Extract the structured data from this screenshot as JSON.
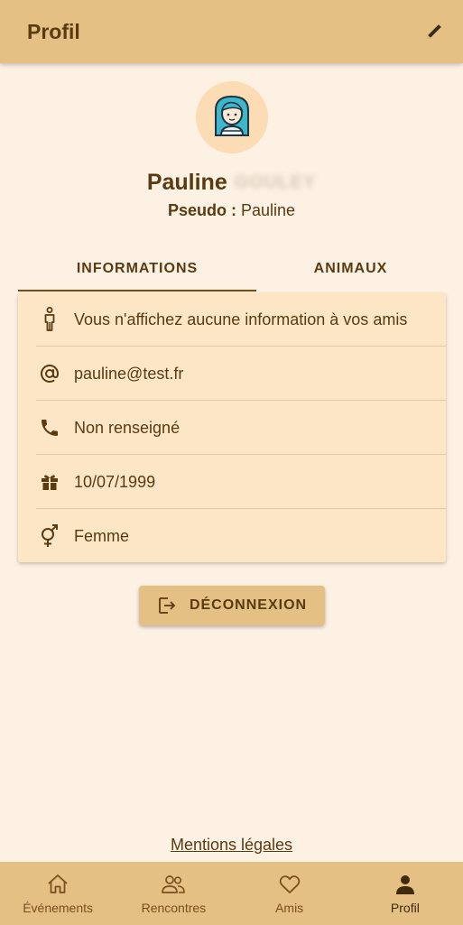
{
  "appbar": {
    "title": "Profil",
    "edit_icon": "pencil-icon"
  },
  "profile": {
    "first_name": "Pauline",
    "last_name": "GOULEY",
    "pseudo_label": "Pseudo :",
    "pseudo_value": "Pauline",
    "avatar_icon": "woman-avatar-icon"
  },
  "tabs": [
    {
      "label": "INFORMATIONS",
      "selected": true
    },
    {
      "label": "ANIMAUX",
      "selected": false
    }
  ],
  "info": [
    {
      "icon": "person-standing-icon",
      "text": "Vous n'affichez aucune information à vos amis"
    },
    {
      "icon": "at-sign-icon",
      "text": "pauline@test.fr"
    },
    {
      "icon": "phone-icon",
      "text": "Non renseigné"
    },
    {
      "icon": "gift-icon",
      "text": "10/07/1999"
    },
    {
      "icon": "gender-icon",
      "text": "Femme"
    }
  ],
  "logout": {
    "label": "DÉCONNEXION",
    "icon": "logout-icon"
  },
  "legal_link": "Mentions légales",
  "bottom_nav": [
    {
      "label": "Événements",
      "icon": "home-icon",
      "active": false
    },
    {
      "label": "Rencontres",
      "icon": "people-icon",
      "active": false
    },
    {
      "label": "Amis",
      "icon": "heart-icon",
      "active": false
    },
    {
      "label": "Profil",
      "icon": "person-icon",
      "active": true
    }
  ],
  "colors": {
    "background": "#fdf1e3",
    "bar": "#e5c085",
    "card": "#fde6c6",
    "text": "#5a3a10"
  }
}
